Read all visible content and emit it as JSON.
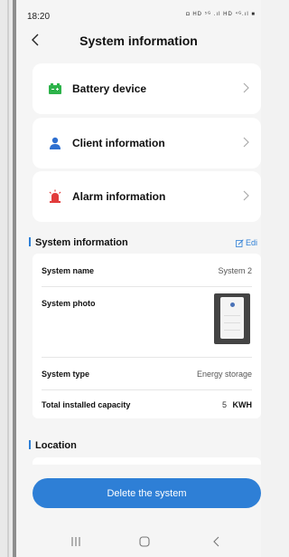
{
  "status_bar": {
    "time": "18:20",
    "icons": "◘ HD ⁵ᴳ .ıl HD ⁴ᴳ.ıl ■"
  },
  "header": {
    "title": "System information"
  },
  "menu": [
    {
      "label": "Battery device",
      "icon": "battery-icon",
      "color": "#2db34a"
    },
    {
      "label": "Client information",
      "icon": "person-icon",
      "color": "#2e6fd0"
    },
    {
      "label": "Alarm information",
      "icon": "alarm-siren-icon",
      "color": "#e23b3b"
    }
  ],
  "system_section": {
    "title": "System information",
    "edit_label": "Edi",
    "rows": {
      "name_label": "System name",
      "name_value": "System 2",
      "photo_label": "System photo",
      "type_label": "System type",
      "type_value": "Energy storage",
      "capacity_label": "Total installed capacity",
      "capacity_value": "5",
      "capacity_unit": "KWH"
    }
  },
  "location_section": {
    "title": "Location"
  },
  "actions": {
    "delete_label": "Delete the system"
  },
  "colors": {
    "accent": "#2e7fd6",
    "background": "#f5f5f5"
  }
}
